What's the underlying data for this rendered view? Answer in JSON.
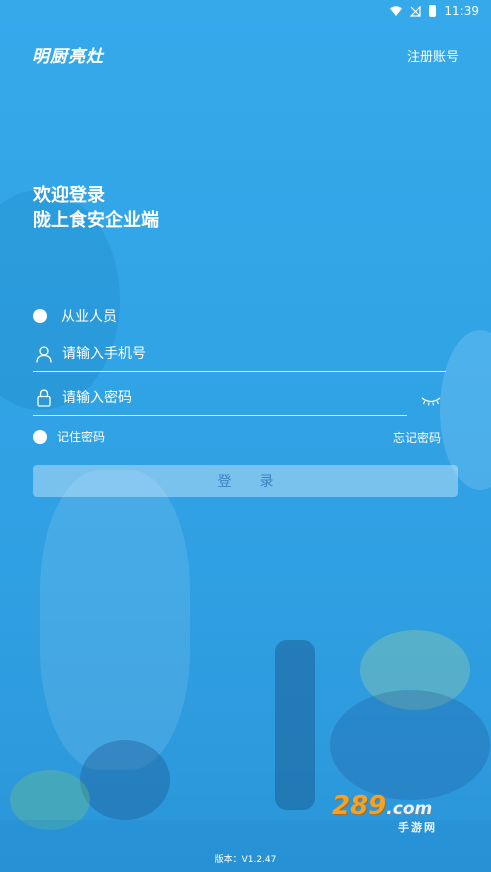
{
  "status_bar": {
    "time": "11:39"
  },
  "header": {
    "logo_text": "明厨亮灶",
    "register_label": "注册账号"
  },
  "welcome": {
    "line1": "欢迎登录",
    "line2": "陇上食安企业端"
  },
  "role": {
    "label": "从业人员",
    "selected": true
  },
  "phone_field": {
    "placeholder": "请输入手机号",
    "value": ""
  },
  "password_field": {
    "placeholder": "请输入密码",
    "value": ""
  },
  "remember": {
    "label": "记住密码",
    "checked": false
  },
  "forgot_label": "忘记密码",
  "login_label": "登录",
  "watermark": {
    "main": "289",
    "suffix": ".com",
    "sub": "手游网"
  },
  "version_text": "版本：V1.2.47",
  "colors": {
    "background": "#31a4e6",
    "button_text": "#3b84c2",
    "watermark": "#f2a22a"
  }
}
